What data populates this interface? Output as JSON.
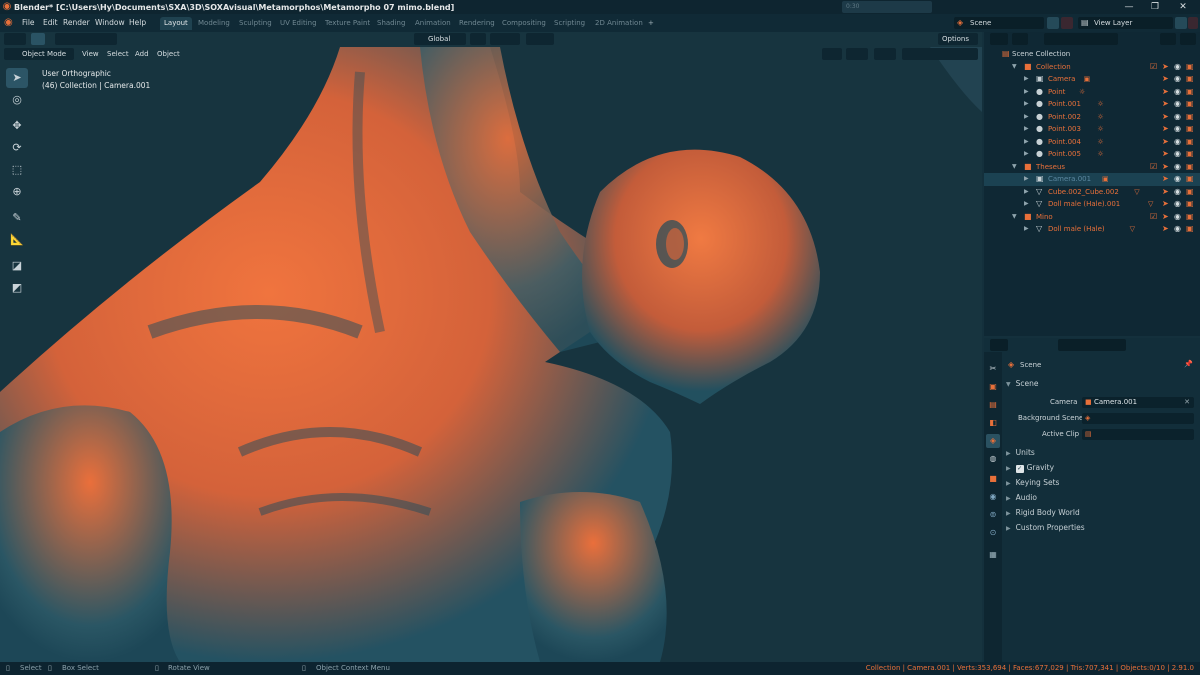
{
  "window": {
    "title": "Blender* [C:\\Users\\Hy\\Documents\\SXA\\3D\\SOXAvisual\\Metamorphos\\Metamorpho 07 mimo.blend]",
    "overlay_time": "0:30",
    "controls": [
      "—",
      "❐",
      "✕"
    ]
  },
  "menus": [
    "File",
    "Edit",
    "Render",
    "Window",
    "Help"
  ],
  "workspaces": [
    "Layout",
    "Modeling",
    "Sculpting",
    "UV Editing",
    "Texture Paint",
    "Shading",
    "Animation",
    "Rendering",
    "Compositing",
    "Scripting",
    "2D Animation"
  ],
  "active_workspace": "Layout",
  "add_workspace": "+",
  "scene_selector": "Scene",
  "view_layer_selector": "View Layer",
  "viewport": {
    "mode": "Object Mode",
    "menus": [
      "View",
      "Select",
      "Add",
      "Object"
    ],
    "transform_orientation": "Global",
    "options_label": "Options",
    "view_name": "User Orthographic",
    "view_info": "(46) Collection | Camera.001"
  },
  "outliner": {
    "search_placeholder": "",
    "rows": [
      {
        "label": "Scene Collection",
        "icon": "scene-collection-icon",
        "level": 0
      },
      {
        "label": "Collection",
        "icon": "collection-icon",
        "level": 1,
        "expanded": true,
        "checkbox": true
      },
      {
        "label": "Camera",
        "icon": "camera-icon",
        "level": 2
      },
      {
        "label": "Point",
        "icon": "light-icon",
        "level": 2
      },
      {
        "label": "Point.001",
        "icon": "light-icon",
        "level": 2
      },
      {
        "label": "Point.002",
        "icon": "light-icon",
        "level": 2
      },
      {
        "label": "Point.003",
        "icon": "light-icon",
        "level": 2
      },
      {
        "label": "Point.004",
        "icon": "light-icon",
        "level": 2
      },
      {
        "label": "Point.005",
        "icon": "light-icon",
        "level": 2
      },
      {
        "label": "Theseus",
        "icon": "collection-icon",
        "level": 1,
        "expanded": true,
        "checkbox": true
      },
      {
        "label": "Camera.001",
        "icon": "camera-icon",
        "level": 2,
        "selected": true,
        "dim": true
      },
      {
        "label": "Cube.002_Cube.002",
        "icon": "mesh-icon",
        "level": 2
      },
      {
        "label": "Doll male (Hale).001",
        "icon": "mesh-icon",
        "level": 2
      },
      {
        "label": "Mino",
        "icon": "collection-icon",
        "level": 1,
        "expanded": true,
        "checkbox": true
      },
      {
        "label": "Doll male (Hale)",
        "icon": "mesh-icon",
        "level": 2
      }
    ]
  },
  "properties": {
    "search_placeholder": "",
    "context": "Scene",
    "panel_title": "Scene",
    "fields": [
      {
        "label": "Camera",
        "value": "Camera.001"
      },
      {
        "label": "Background Scene",
        "value": ""
      },
      {
        "label": "Active Clip",
        "value": ""
      }
    ],
    "collapsed_panels": [
      "Units",
      "Gravity",
      "Keying Sets",
      "Audio",
      "Rigid Body World",
      "Custom Properties"
    ],
    "gravity_checked": true
  },
  "statusbar": {
    "select": "Select",
    "box_select": "Box Select",
    "rotate_view": "Rotate View",
    "context_menu": "Object Context Menu",
    "stats": "Collection | Camera.001 | Verts:353,694 | Faces:677,029 | Tris:707,341 | Objects:0/10 | 2.91.0"
  },
  "colors": {
    "accent": "#e8703a",
    "background": "#14303c",
    "mesh_dark": "#1c4a5a",
    "mesh_light": "#e8703a"
  }
}
